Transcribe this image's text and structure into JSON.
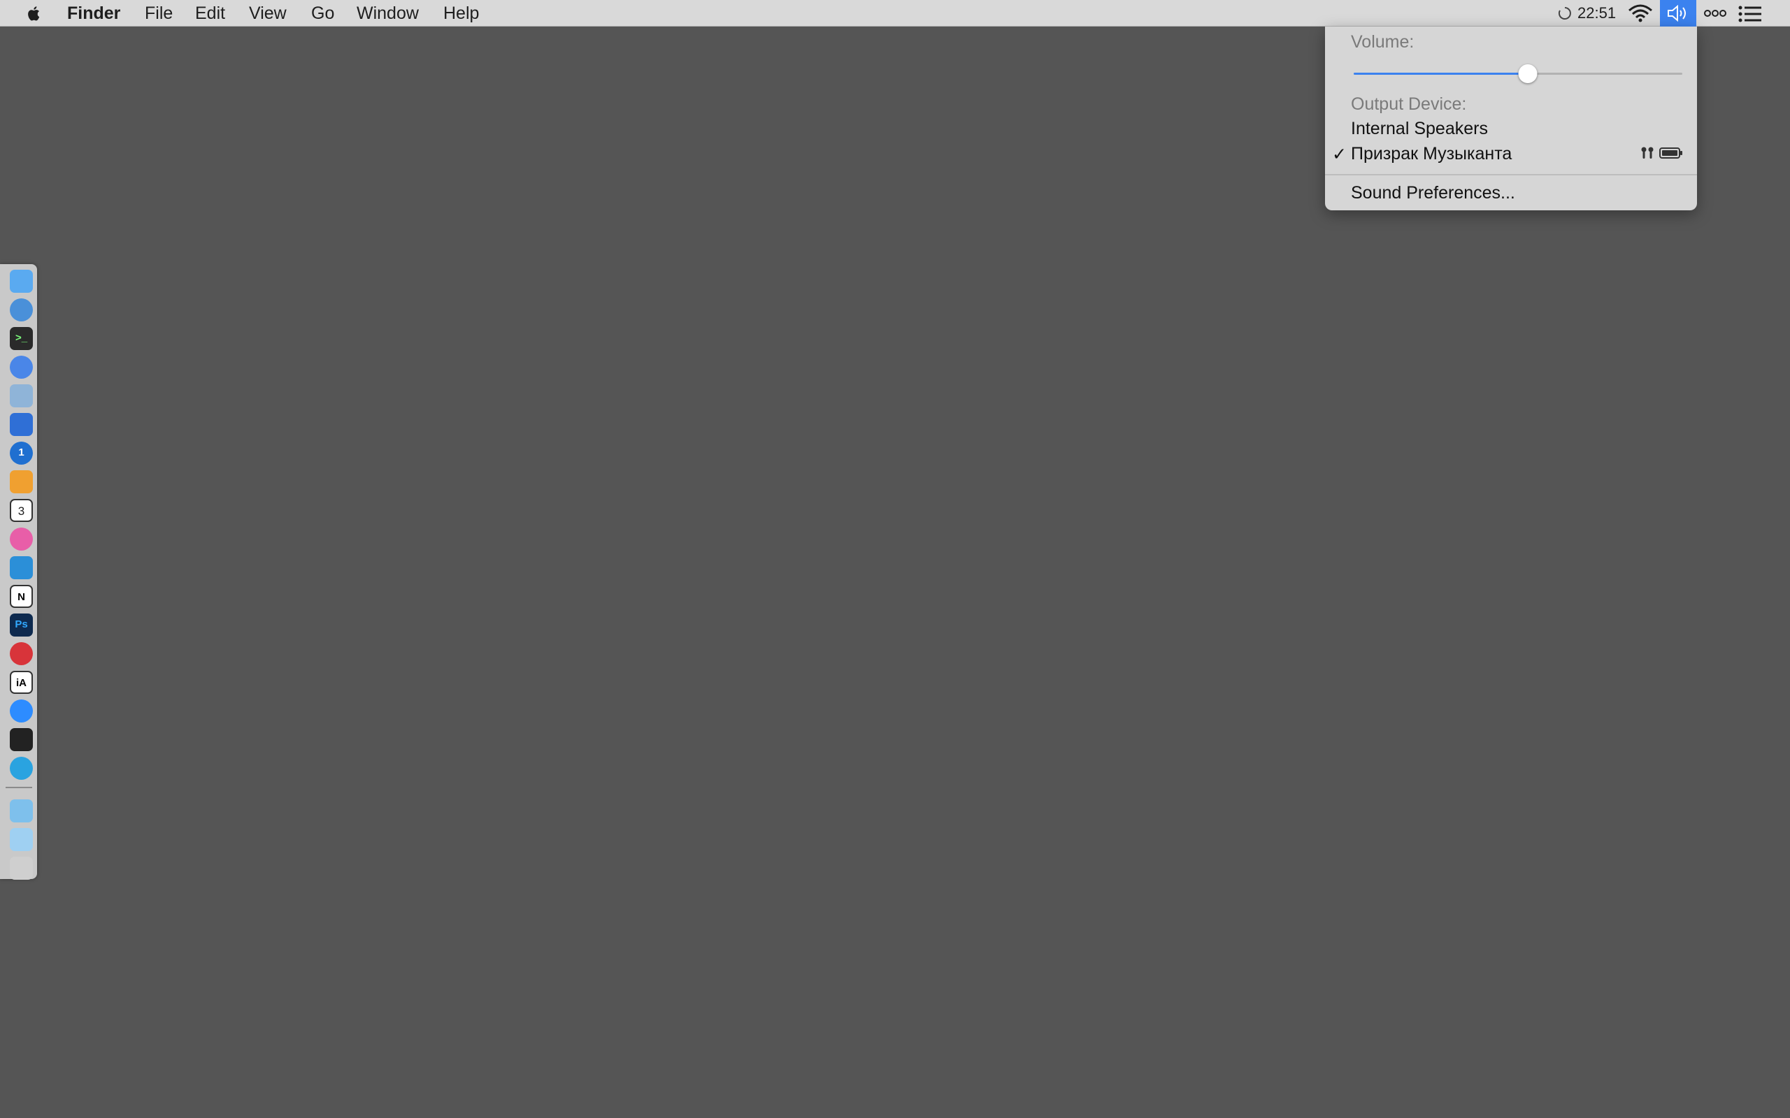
{
  "menubar": {
    "apple_icon": "apple-logo-icon",
    "app_name": "Finder",
    "items": [
      "File",
      "Edit",
      "View",
      "Go",
      "Window",
      "Help"
    ],
    "clock": "22:51",
    "status_icons": [
      "loading-spinner-icon",
      "wifi-icon",
      "volume-icon",
      "more-icon",
      "notification-list-icon"
    ]
  },
  "volume_menu": {
    "volume_label": "Volume:",
    "volume_level_percent": 53,
    "output_label": "Output Device:",
    "devices": [
      {
        "name": "Internal Speakers",
        "selected": false
      },
      {
        "name": "Призрак Музыканта",
        "selected": true,
        "icons": [
          "airpods-icon",
          "battery-icon"
        ]
      }
    ],
    "checkmark": "✓",
    "sound_preferences": "Sound Preferences..."
  },
  "dock": {
    "apps": [
      {
        "name": "finder-icon",
        "color": "#5aaaf0"
      },
      {
        "name": "safari-icon",
        "color": "#4a90d9"
      },
      {
        "name": "terminal-icon",
        "color": "#2a2a2a"
      },
      {
        "name": "chrome-icon",
        "color": "#4a86e8"
      },
      {
        "name": "preview-icon",
        "color": "#8fb4d8"
      },
      {
        "name": "tasks-icon",
        "color": "#2f6fd6"
      },
      {
        "name": "1password-icon",
        "color": "#1f6fd0"
      },
      {
        "name": "pages-icon",
        "color": "#f0a030"
      },
      {
        "name": "calendar-icon",
        "color": "#ffffff"
      },
      {
        "name": "itunes-icon",
        "color": "#e85ea8"
      },
      {
        "name": "vscode-icon",
        "color": "#2b8fd8"
      },
      {
        "name": "notion-icon",
        "color": "#ffffff"
      },
      {
        "name": "photoshop-icon",
        "color": "#0e2a4f"
      },
      {
        "name": "red-app-icon",
        "color": "#d8343a"
      },
      {
        "name": "ia-writer-icon",
        "color": "#ffffff"
      },
      {
        "name": "zoom-icon",
        "color": "#2d8cff"
      },
      {
        "name": "activity-monitor-icon",
        "color": "#222222"
      },
      {
        "name": "telegram-icon",
        "color": "#2aa3e0"
      }
    ],
    "others": [
      {
        "name": "applications-folder-icon",
        "color": "#7ec0ec"
      },
      {
        "name": "downloads-folder-icon",
        "color": "#9fd0f2"
      },
      {
        "name": "trash-icon",
        "color": "#cfcfcf"
      }
    ],
    "calendar_badge": "3"
  },
  "colors": {
    "accent": "#3b82ef",
    "desktop": "#555555",
    "menubar": "#d9d9d9"
  }
}
